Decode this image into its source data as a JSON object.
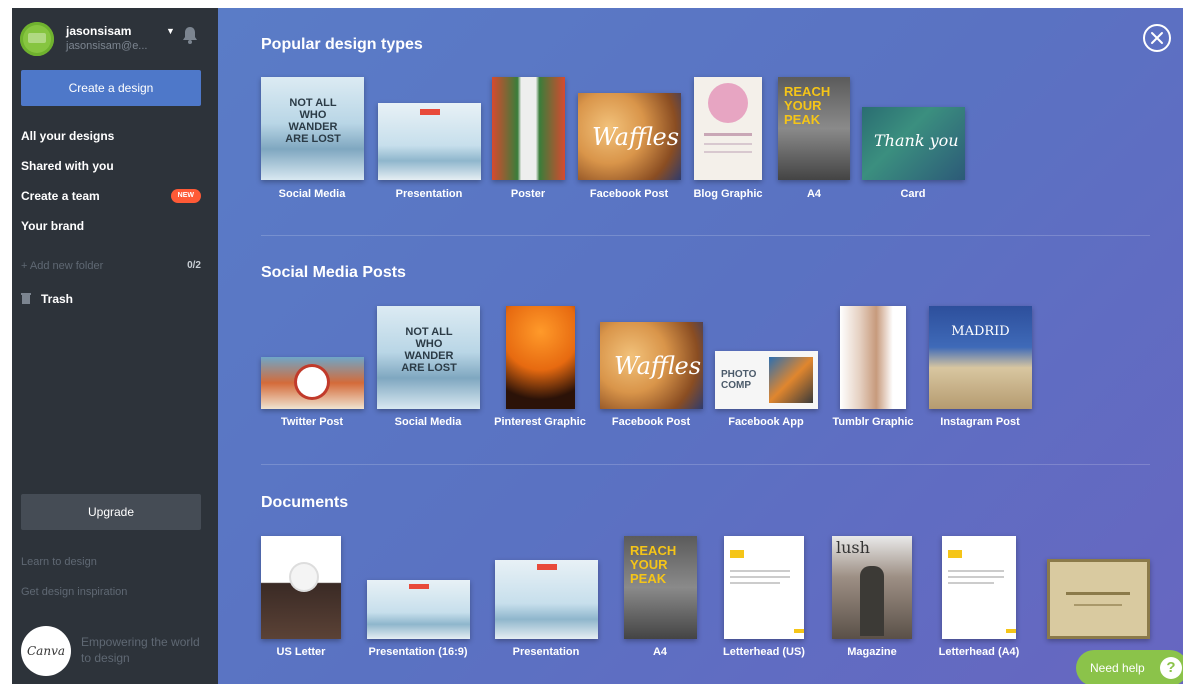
{
  "sidebar": {
    "user": {
      "name": "jasonsisam",
      "email": "jasonsisam@e..."
    },
    "create_label": "Create a design",
    "nav": [
      {
        "label": "All your designs"
      },
      {
        "label": "Shared with you"
      },
      {
        "label": "Create a team",
        "badge": "NEW"
      },
      {
        "label": "Your brand"
      }
    ],
    "add_folder_label": "+ Add new folder",
    "folder_count": "0/2",
    "trash_label": "Trash",
    "upgrade_label": "Upgrade",
    "learn_label": "Learn to design",
    "inspire_label": "Get design inspiration",
    "logo_text": "Canva",
    "tagline": "Empowering the world to design"
  },
  "main": {
    "sections": [
      {
        "title": "Popular design types",
        "items": [
          "Social Media",
          "Presentation",
          "Poster",
          "Facebook Post",
          "Blog Graphic",
          "A4",
          "Card"
        ]
      },
      {
        "title": "Social Media Posts",
        "items": [
          "Twitter Post",
          "Social Media",
          "Pinterest Graphic",
          "Facebook Post",
          "Facebook App",
          "Tumblr Graphic",
          "Instagram Post"
        ]
      },
      {
        "title": "Documents",
        "items": [
          "US Letter",
          "Presentation (16:9)",
          "Presentation",
          "A4",
          "Letterhead (US)",
          "Magazine",
          "Letterhead (A4)"
        ]
      }
    ],
    "thumb_text": {
      "not_all": "NOT ALL WHO WANDER ARE LOST",
      "waffles": "Waffles",
      "reach": "REACH YOUR PEAK",
      "thank_you": "Thank you",
      "photo_comp": "PHOTO COMP",
      "madrid": "MADRID",
      "lush": "lush"
    }
  },
  "help": {
    "label": "Need help",
    "icon": "?"
  },
  "colors": {
    "sidebar_bg": "#2d333a",
    "primary_button": "#4e78c9",
    "new_badge": "#ff5a36",
    "help_green": "#8bc34a"
  }
}
